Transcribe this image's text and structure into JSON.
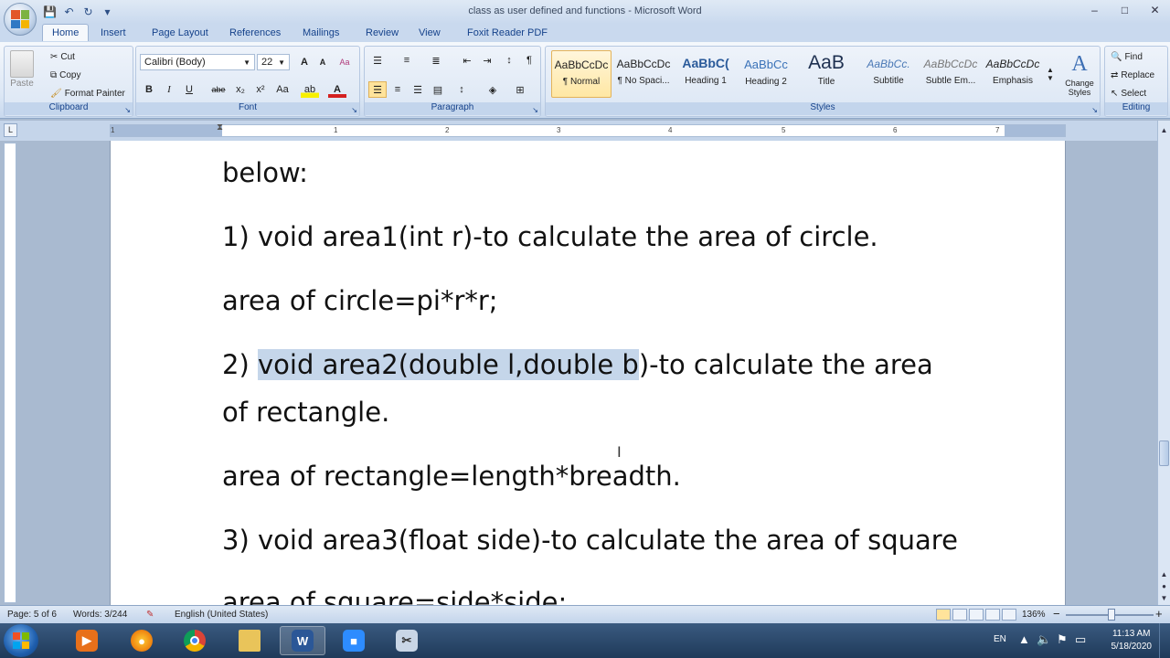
{
  "window": {
    "title": "class as user defined and functions - Microsoft Word",
    "minimize": "–",
    "maximize": "□",
    "close": "✕"
  },
  "qat": {
    "save": "💾",
    "undo": "↶",
    "redo": "↻",
    "customize": "▾"
  },
  "tabs": [
    "Home",
    "Insert",
    "Page Layout",
    "References",
    "Mailings",
    "Review",
    "View",
    "Foxit Reader PDF"
  ],
  "ribbon": {
    "clipboard": {
      "label": "Clipboard",
      "paste": "Paste",
      "cut": "Cut",
      "copy": "Copy",
      "format_painter": "Format Painter"
    },
    "font": {
      "label": "Font",
      "font_name": "Calibri (Body)",
      "font_size": "22",
      "grow": "A",
      "shrink": "A",
      "clear": "Aa",
      "bold": "B",
      "italic": "I",
      "underline": "U",
      "strike": "abe",
      "subscript": "x₂",
      "superscript": "x²",
      "change_case": "Aa",
      "highlight": "ab",
      "font_color": "A"
    },
    "paragraph": {
      "label": "Paragraph",
      "pilcrow": "¶"
    },
    "styles": {
      "label": "Styles",
      "items": [
        {
          "sample": "AaBbCcDc",
          "name": "¶ Normal"
        },
        {
          "sample": "AaBbCcDc",
          "name": "¶ No Spaci..."
        },
        {
          "sample": "AaBbC(",
          "name": "Heading 1"
        },
        {
          "sample": "AaBbCc",
          "name": "Heading 2"
        },
        {
          "sample": "AaB",
          "name": "Title"
        },
        {
          "sample": "AaBbCc.",
          "name": "Subtitle"
        },
        {
          "sample": "AaBbCcDc",
          "name": "Subtle Em..."
        },
        {
          "sample": "AaBbCcDc",
          "name": "Emphasis"
        }
      ],
      "change_styles": "Change Styles"
    },
    "editing": {
      "label": "Editing",
      "find": "Find",
      "replace": "Replace",
      "select": "Select"
    }
  },
  "ruler": {
    "ticks": [
      "1",
      "1",
      "2",
      "3",
      "4",
      "5",
      "6",
      "7"
    ],
    "corner": "L"
  },
  "document": {
    "line1": "below:",
    "line2": "1) void area1(int r)-to calculate the area of circle.",
    "line3": "area of circle=pi*r*r;",
    "line4_prefix": "2) ",
    "line4_selected": "void area2(double l,double b",
    "line4_rest": ")-to calculate the area",
    "line5": "of rectangle.",
    "line6": "area of rectangle=length*breadth.",
    "line7": "3) void area3(float side)-to calculate the area of square",
    "line8": "area of square=side*side;"
  },
  "status": {
    "page": "Page: 5 of 6",
    "words": "Words: 3/244",
    "language": "English (United States)",
    "zoom": "136%",
    "zoom_out": "−",
    "zoom_in": "+"
  },
  "taskbar": {
    "language": "EN",
    "time": "11:13 AM",
    "date": "5/18/2020"
  },
  "colors": {
    "selection": "#c5d6ea",
    "ribbon_text": "#15428b",
    "taskbar": "#1f3a5a"
  }
}
